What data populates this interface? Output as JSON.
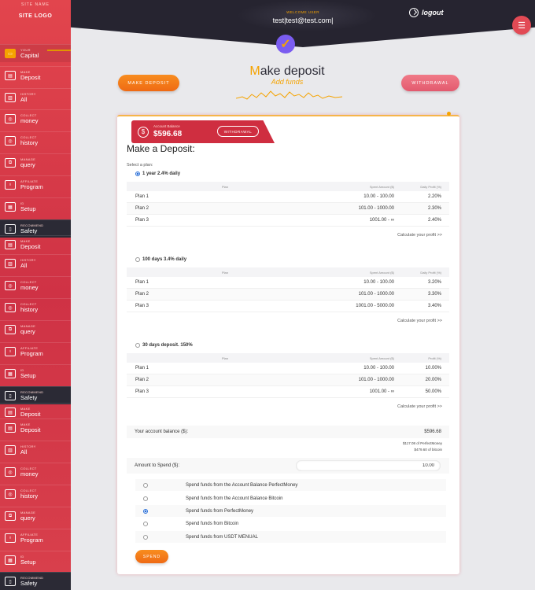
{
  "site": {
    "name": "SITE NAME",
    "logo": "SITE LOGO"
  },
  "sidebar": {
    "items": [
      {
        "l1": "YOUR",
        "l2": "Capital",
        "icon": "wallet-icon",
        "dark": false,
        "active": true
      },
      {
        "l1": "MAKE",
        "l2": "Deposit",
        "icon": "deposit-icon",
        "dark": false
      },
      {
        "l1": "HISTORY",
        "l2": "All",
        "icon": "history-icon",
        "dark": false
      },
      {
        "l1": "COLLECT",
        "l2": "money",
        "icon": "coins-icon",
        "dark": false
      },
      {
        "l1": "COLLECT",
        "l2": "history",
        "icon": "coins-icon",
        "dark": false
      },
      {
        "l1": "MANAGE",
        "l2": "query",
        "icon": "chart-icon",
        "dark": false
      },
      {
        "l1": "AFFILIATE",
        "l2": "Program",
        "icon": "affiliate-icon",
        "dark": false
      },
      {
        "l1": "ID",
        "l2": "Setup",
        "icon": "id-icon",
        "dark": false
      },
      {
        "l1": "RECOMMEND",
        "l2": "Safety",
        "icon": "phone-icon",
        "dark": true
      },
      {
        "l1": "MAKE",
        "l2": "Deposit",
        "icon": "deposit-icon",
        "dark": false
      },
      {
        "l1": "HISTORY",
        "l2": "All",
        "icon": "history-icon",
        "dark": false
      },
      {
        "l1": "COLLECT",
        "l2": "money",
        "icon": "coins-icon",
        "dark": false
      },
      {
        "l1": "COLLECT",
        "l2": "history",
        "icon": "coins-icon",
        "dark": false
      },
      {
        "l1": "MANAGE",
        "l2": "query",
        "icon": "chart-icon",
        "dark": false
      },
      {
        "l1": "AFFILIATE",
        "l2": "Program",
        "icon": "affiliate-icon",
        "dark": false
      },
      {
        "l1": "ID",
        "l2": "Setup",
        "icon": "id-icon",
        "dark": false
      },
      {
        "l1": "RECOMMEND",
        "l2": "Safety",
        "icon": "phone-icon",
        "dark": true
      },
      {
        "l1": "MAKE",
        "l2": "Deposit",
        "icon": "deposit-icon",
        "dark": false
      },
      {
        "l1": "MAKE",
        "l2": "Deposit",
        "icon": "deposit-icon",
        "dark": false
      },
      {
        "l1": "HISTORY",
        "l2": "All",
        "icon": "history-icon",
        "dark": false
      },
      {
        "l1": "COLLECT",
        "l2": "money",
        "icon": "coins-icon",
        "dark": false
      },
      {
        "l1": "COLLECT",
        "l2": "history",
        "icon": "coins-icon",
        "dark": false
      },
      {
        "l1": "MANAGE",
        "l2": "query",
        "icon": "chart-icon",
        "dark": false
      },
      {
        "l1": "AFFILIATE",
        "l2": "Program",
        "icon": "affiliate-icon",
        "dark": false
      },
      {
        "l1": "ID",
        "l2": "Setup",
        "icon": "id-icon",
        "dark": false
      },
      {
        "l1": "RECOMMEND",
        "l2": "Safety",
        "icon": "phone-icon",
        "dark": true
      }
    ]
  },
  "header": {
    "welcome_label": "WELCOME USER",
    "user": "test|test@test.com|",
    "logout": "logout",
    "menu_icon": "hamburger-icon"
  },
  "page": {
    "title_first": "M",
    "title_rest": "ake deposit",
    "subtitle": "Add funds"
  },
  "buttons": {
    "make_deposit": "MAKE DEPOSIT",
    "withdrawal": "WITHDRAWAL",
    "spend": "SPEND"
  },
  "balance_banner": {
    "label": "Account Balance",
    "amount": "$596.68",
    "withdraw_btn": "WITHDRAWAL"
  },
  "form": {
    "title": "Make a Deposit:",
    "select_label": "Select a plan:",
    "calc_link": "Calculate your profit >>"
  },
  "table_headers": {
    "plan": "Plan",
    "amount": "Spent Amount ($)",
    "profit": "Daily Profit (%)",
    "profit_alt": "Profit (%)"
  },
  "plans": [
    {
      "name": "1 year 2.4% daily",
      "selected": true,
      "headers": [
        "Plan",
        "Spent Amount ($)",
        "Daily Profit (%)"
      ],
      "rows": [
        [
          "Plan 1",
          "10.00 - 100.00",
          "2.20%"
        ],
        [
          "Plan 2",
          "101.00 - 1000.00",
          "2.30%"
        ],
        [
          "Plan 3",
          "1001.00 - ∞",
          "2.40%"
        ]
      ]
    },
    {
      "name": "100 days 3.4% daily",
      "selected": false,
      "headers": [
        "Plan",
        "Spent Amount ($)",
        "Daily Profit (%)"
      ],
      "rows": [
        [
          "Plan 1",
          "10.00 - 100.00",
          "3.20%"
        ],
        [
          "Plan 2",
          "101.00 - 1000.00",
          "3.30%"
        ],
        [
          "Plan 3",
          "1001.00 - 5000.00",
          "3.40%"
        ]
      ]
    },
    {
      "name": "30 days deposit. 150%",
      "selected": false,
      "headers": [
        "Plan",
        "Spent Amount ($)",
        "Profit (%)"
      ],
      "rows": [
        [
          "Plan 1",
          "10.00 - 100.00",
          "10.00%"
        ],
        [
          "Plan 2",
          "101.00 - 1000.00",
          "20.00%"
        ],
        [
          "Plan 3",
          "1001.00 - ∞",
          "50.00%"
        ]
      ]
    }
  ],
  "account": {
    "label": "Your account balance ($):",
    "value": "$596.68",
    "pm": "$117.08 of PerfectMoney",
    "btc": "$479.60 of bitcoin"
  },
  "amount": {
    "label": "Amount to Spend ($):",
    "value": "10.00"
  },
  "spend_options": [
    {
      "label": "Spend funds from the Account Balance PerfectMoney",
      "selected": false
    },
    {
      "label": "Spend funds from the Account Balance Bitcoin",
      "selected": false
    },
    {
      "label": "Spend funds from PerfectMoney",
      "selected": true
    },
    {
      "label": "Spend funds from Bitcoin",
      "selected": false
    },
    {
      "label": "Spend funds from USDT MENUAL",
      "selected": false
    }
  ],
  "colors": {
    "accent": "#f5a300",
    "brand_red": "#e24a55",
    "dark": "#262430",
    "orange_btn": "#f07a1a"
  }
}
